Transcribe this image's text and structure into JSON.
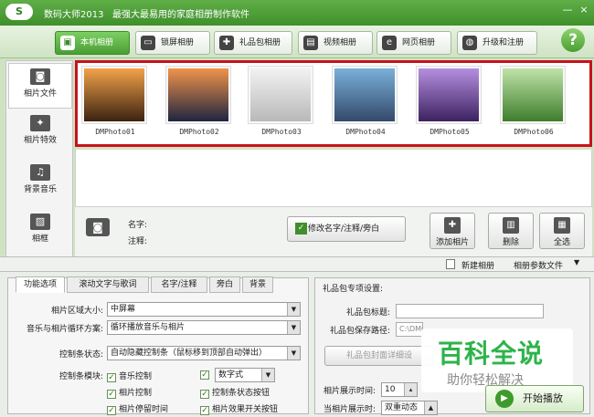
{
  "window": {
    "title": "数码大师2013   最强大最易用的家庭相册制作软件",
    "logo_text": "S",
    "minimize": "—",
    "close": "×"
  },
  "tabs": [
    {
      "label": "本机相册",
      "icon": "photo-album-icon"
    },
    {
      "label": "锁屏相册",
      "icon": "monitor-icon"
    },
    {
      "label": "礼品包相册",
      "icon": "gift-icon"
    },
    {
      "label": "视频相册",
      "icon": "film-icon"
    },
    {
      "label": "网页相册",
      "icon": "ie-icon"
    },
    {
      "label": "升级和注册",
      "icon": "globe-icon"
    }
  ],
  "help": "?",
  "sidebar": [
    {
      "label": "相片文件",
      "icon": "camera-icon"
    },
    {
      "label": "相片特效",
      "icon": "sparkle-icon"
    },
    {
      "label": "背景音乐",
      "icon": "music-note-icon"
    },
    {
      "label": "相框",
      "icon": "frame-icon"
    }
  ],
  "photos": [
    {
      "caption": "DMPhoto01",
      "colors": [
        "#f3a24a",
        "#3b2210"
      ]
    },
    {
      "caption": "DMPhoto02",
      "colors": [
        "#f0934a",
        "#1f2540"
      ]
    },
    {
      "caption": "DMPhoto03",
      "colors": [
        "#f2f2f2",
        "#b9b9b9"
      ]
    },
    {
      "caption": "DMPhoto04",
      "colors": [
        "#7ab0d9",
        "#34496b"
      ]
    },
    {
      "caption": "DMPhoto05",
      "colors": [
        "#b58fe0",
        "#3d2260"
      ]
    },
    {
      "caption": "DMPhoto06",
      "colors": [
        "#bfe3a8",
        "#3f7d2c"
      ]
    }
  ],
  "info": {
    "name_label": "名字:",
    "note_label": "注释:",
    "edit_button": "修改名字/注释/旁白",
    "add_button": "添加相片",
    "delete_button": "删除",
    "select_all_button": "全选"
  },
  "subbar": {
    "new_album": "新建相册",
    "album_params": "相册参数文件"
  },
  "bottom_tabs": [
    "功能选项",
    "滚动文字与歌词",
    "名字/注释",
    "旁白",
    "背景"
  ],
  "options": {
    "area_size_label": "相片区域大小:",
    "area_size_value": "中屏幕",
    "loop_label": "音乐与相片循环方案:",
    "loop_value": "循环播放音乐与相片",
    "control_state_label": "控制条状态:",
    "control_state_value": "自动隐藏控制条（鼠标移到顶部自动弹出）",
    "control_module_label": "控制条模块:",
    "checks": [
      "音乐控制",
      "相片控制",
      "相片停留时间",
      "数字式",
      "控制条状态按钮",
      "相片效果开关按钮"
    ]
  },
  "gift": {
    "header": "礼品包专项设置:",
    "title_label": "礼品包标题:",
    "path_label": "礼品包保存路径:",
    "path_value": "C:\\DMGi",
    "cover_button": "礼品包封面详细设"
  },
  "display": {
    "time_label": "相片展示时间:",
    "time_value": "10",
    "current_label": "当相片展示时:",
    "current_value": "双重动态"
  },
  "watermark": {
    "brand": "百科全说",
    "slogan": "助你轻松解决"
  },
  "play": {
    "label": "开始播放",
    "icon": "play-icon"
  }
}
